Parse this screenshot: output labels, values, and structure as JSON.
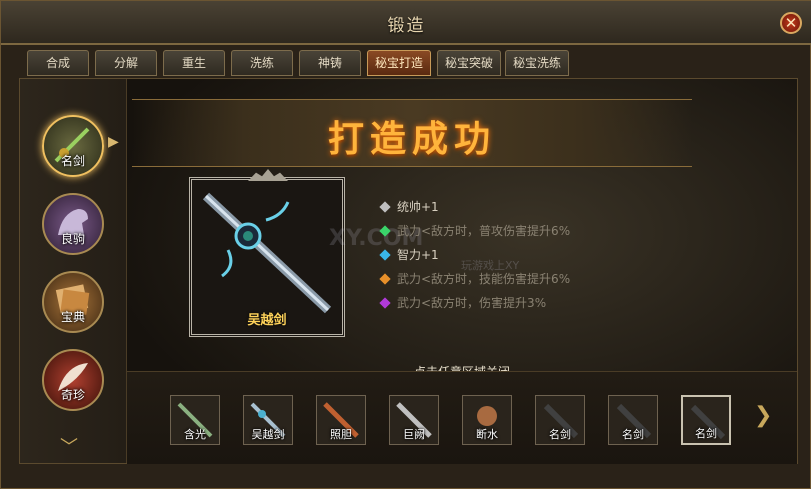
{
  "window": {
    "title": "锻造",
    "close_label": "✕"
  },
  "tabs": [
    {
      "label": "合成"
    },
    {
      "label": "分解"
    },
    {
      "label": "重生"
    },
    {
      "label": "洗练"
    },
    {
      "label": "神铸"
    },
    {
      "label": "秘宝打造",
      "active": true
    },
    {
      "label": "秘宝突破"
    },
    {
      "label": "秘宝洗练"
    }
  ],
  "sidebar": {
    "items": [
      {
        "label": "名剑",
        "active": true
      },
      {
        "label": "良驹"
      },
      {
        "label": "宝典"
      },
      {
        "label": "奇珍"
      }
    ]
  },
  "result": {
    "banner": "打造成功",
    "item_name": "吴越剑",
    "stats": [
      {
        "text": "统帅+1",
        "gem": "#bfbfbf",
        "dim": false
      },
      {
        "text": "武力<敌方时，普攻伤害提升6%",
        "gem": "#3ad46a",
        "dim": true
      },
      {
        "text": "智力+1",
        "gem": "#39b6e8",
        "dim": false
      },
      {
        "text": "武力<敌方时，技能伤害提升6%",
        "gem": "#e8902a",
        "dim": true
      },
      {
        "text": "武力<敌方时，伤害提升3%",
        "gem": "#b03ad8",
        "dim": true
      }
    ],
    "hint": "点击任意区域关闭",
    "watermark": "XY.COM",
    "watermark_sub": "玩游戏上XY"
  },
  "items_bar": [
    {
      "label": "含光"
    },
    {
      "label": "吴越剑"
    },
    {
      "label": "照胆"
    },
    {
      "label": "巨阙"
    },
    {
      "label": "断水"
    },
    {
      "label": "名剑"
    },
    {
      "label": "名剑"
    },
    {
      "label": "名剑",
      "selected": true
    }
  ],
  "colors": {
    "accent": "#ffb43c",
    "item_name": "#ffd35a"
  }
}
